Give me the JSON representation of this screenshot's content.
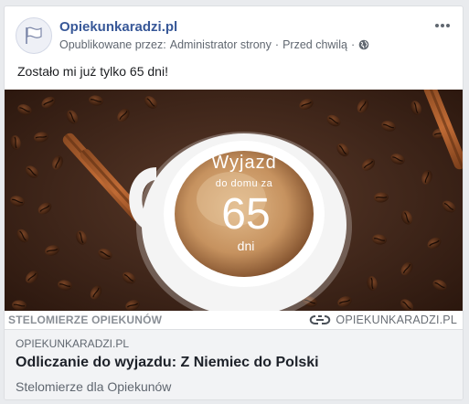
{
  "post": {
    "page_name": "Opiekunkaradzi.pl",
    "byline_prefix": "Opublikowane przez:",
    "author": "Administrator strony",
    "separator": "·",
    "time": "Przed chwilą",
    "privacy_icon": "globe-icon",
    "more_icon": "more-horizontal-icon",
    "text": "Zostało mi już tylko 65 dni!"
  },
  "image": {
    "cup_line1": "Wyjazd",
    "cup_line2": "do domu za",
    "cup_number": "65",
    "cup_line3": "dni",
    "footer_left": "STELOMIERZE OPIEKUNÓW",
    "footer_right": "OPIEKUNKARADZI.PL"
  },
  "link": {
    "domain": "OPIEKUNKARADZI.PL",
    "title": "Odliczanie do wyjazdu: Z Niemiec do Polski",
    "description": "Stelomierze dla Opiekunów"
  },
  "colors": {
    "page_link": "#385898",
    "coffee_dark": "#3b2216",
    "crema": "#c79a6a"
  }
}
